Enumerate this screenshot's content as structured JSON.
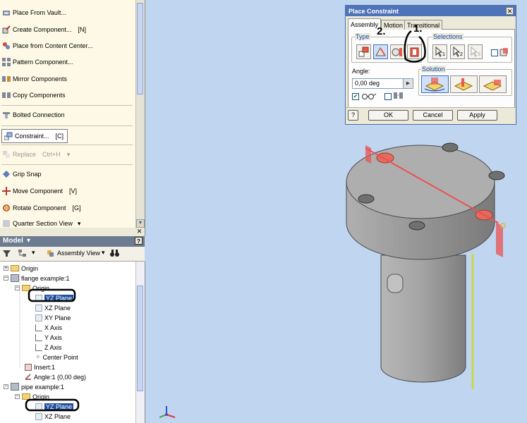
{
  "commands": {
    "place_from_vault": "Place From Vault...",
    "create_component": {
      "label": "Create Component...",
      "key": "[N]"
    },
    "place_from_content_center": "Place from Content Center...",
    "pattern_component": "Pattern Component...",
    "mirror_components": "Mirror Components",
    "copy_components": "Copy Components",
    "bolted_connection": "Bolted Connection",
    "constraint": {
      "label": "Constraint...",
      "key": "[C]"
    },
    "replace": {
      "label": "Replace",
      "key": "Ctrl+H"
    },
    "grip_snap": "Grip Snap",
    "move_component": {
      "label": "Move Component",
      "key": "[V]"
    },
    "rotate_component": {
      "label": "Rotate Component",
      "key": "[G]"
    },
    "quarter_section_view": "Quarter Section View"
  },
  "model": {
    "header": "Model",
    "view_label": "Assembly View",
    "tree": {
      "origin": "Origin",
      "flange": "flange example:1",
      "flange_origin": "Origin",
      "yz_plane": "YZ Plane",
      "xz_plane": "XZ Plane",
      "xy_plane": "XY Plane",
      "x_axis": "X Axis",
      "y_axis": "Y Axis",
      "z_axis": "Z Axis",
      "center_point": "Center Point",
      "insert": "Insert:1",
      "angle": "Angle:1 (0,00 deg)",
      "pipe": "pipe example:1",
      "pipe_origin": "Origin",
      "pipe_yz_plane": "YZ Plane",
      "pipe_xz_plane": "XZ Plane"
    }
  },
  "dialog": {
    "title": "Place Constraint",
    "tabs": [
      "Assembly",
      "Motion",
      "Transitional"
    ],
    "type_label": "Type",
    "selections_label": "Selections",
    "angle_label": "Angle:",
    "angle_value": "0,00 deg",
    "solution_label": "Solution",
    "ok": "OK",
    "cancel": "Cancel",
    "apply": "Apply",
    "help": "?",
    "sel_1": "1",
    "sel_2": "2",
    "sel_3": "3"
  },
  "annotations": {
    "one": "1.",
    "two": "2."
  },
  "colors": {
    "viewport": "#bfd5f0",
    "accent": "#4e73b8",
    "plane_red": "#e9524f",
    "plane_yellow": "#d7e04a"
  }
}
